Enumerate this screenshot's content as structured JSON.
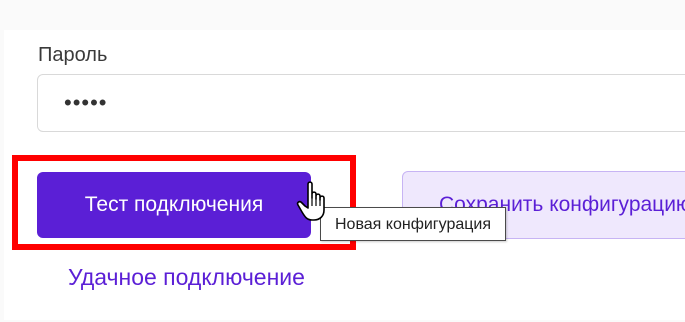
{
  "form": {
    "password_label": "Пароль",
    "password_value": "•••••"
  },
  "actions": {
    "test_connection_label": "Тест подключения",
    "save_config_label": "Сохранить конфигурацию"
  },
  "tooltip": {
    "text": "Новая конфигурация"
  },
  "status": {
    "text": "Удачное подключение"
  },
  "icons": {
    "cursor": "hand-pointer-icon"
  },
  "colors": {
    "primary": "#5b1fd6",
    "secondary_bg": "#efe8fd",
    "highlight": "#ff0000"
  }
}
